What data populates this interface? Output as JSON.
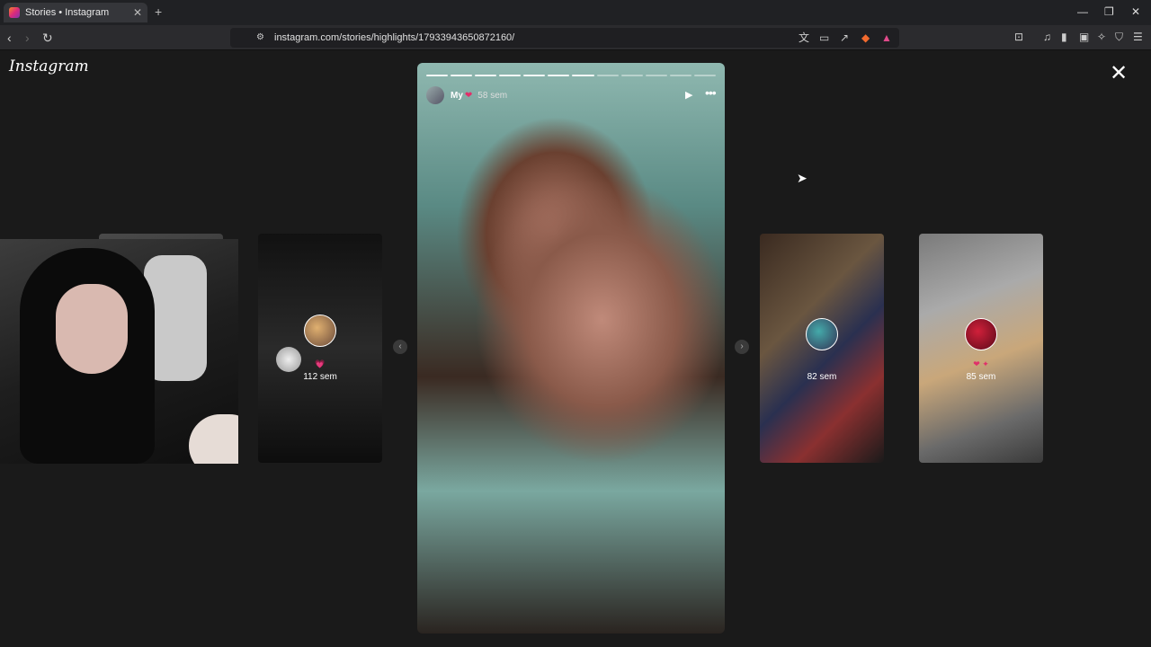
{
  "browser": {
    "tab_title": "Stories • Instagram",
    "tab_close": "✕",
    "new_tab": "+",
    "url": "instagram.com/stories/highlights/17933943650872160/",
    "window_controls": {
      "minimize": "—",
      "restore": "❐",
      "close": "✕"
    }
  },
  "page": {
    "logo": "Instagram",
    "close": "✕"
  },
  "story": {
    "username": "My",
    "user_emoji": "❤",
    "time": "58 sem",
    "progress_total": 12,
    "progress_viewed": 7
  },
  "side_cards": [
    {
      "time": "112 sem",
      "emoji": "💗"
    },
    {
      "time": "82 sem",
      "emoji": ""
    },
    {
      "time": "85 sem",
      "emoji": "❤ ✦"
    }
  ],
  "nav": {
    "prev": "‹",
    "next": "›"
  },
  "colors": {
    "brand_gradient": [
      "#f58529",
      "#dd2a7b",
      "#8134af"
    ],
    "background": "#1a1a1a"
  }
}
